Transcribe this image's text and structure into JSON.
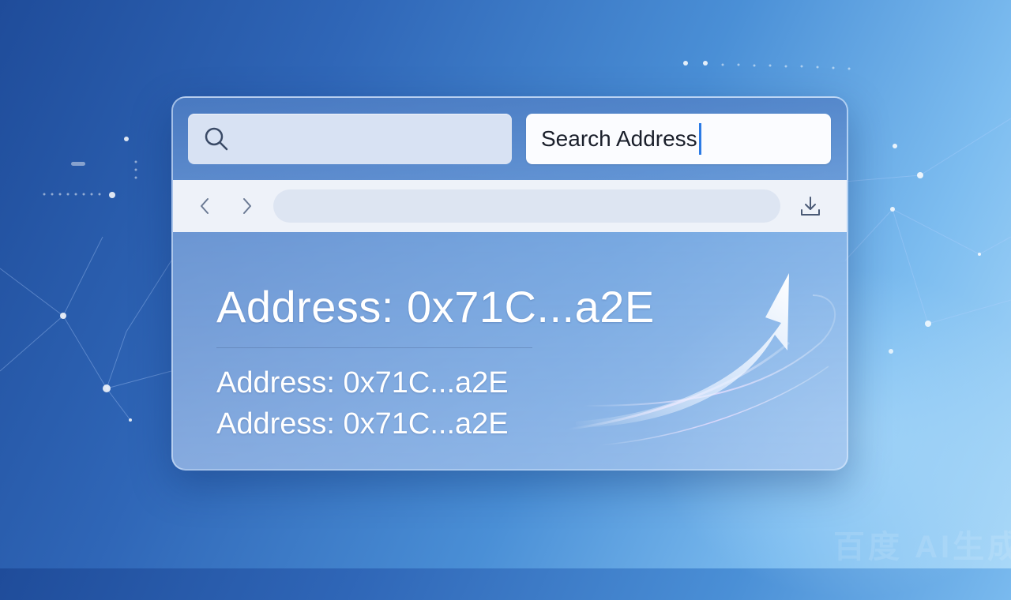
{
  "search": {
    "left_icon": "search-icon",
    "input_value": "Search Address"
  },
  "navbar": {
    "back_icon": "chevron-left-icon",
    "forward_icon": "chevron-right-icon",
    "url_value": "",
    "download_icon": "download-icon"
  },
  "content": {
    "heading": "Address: 0x71C...a2E",
    "lines": [
      "Address: 0x71C...a2E",
      "Address: 0x71C...a2E"
    ],
    "decoration_icon": "trending-up-arrow-icon"
  },
  "watermark": {
    "text": "百度 AI生成"
  },
  "colors": {
    "accent": "#2c7be5",
    "text_light": "#ffffff",
    "panel_glass": "#9db8e6"
  }
}
